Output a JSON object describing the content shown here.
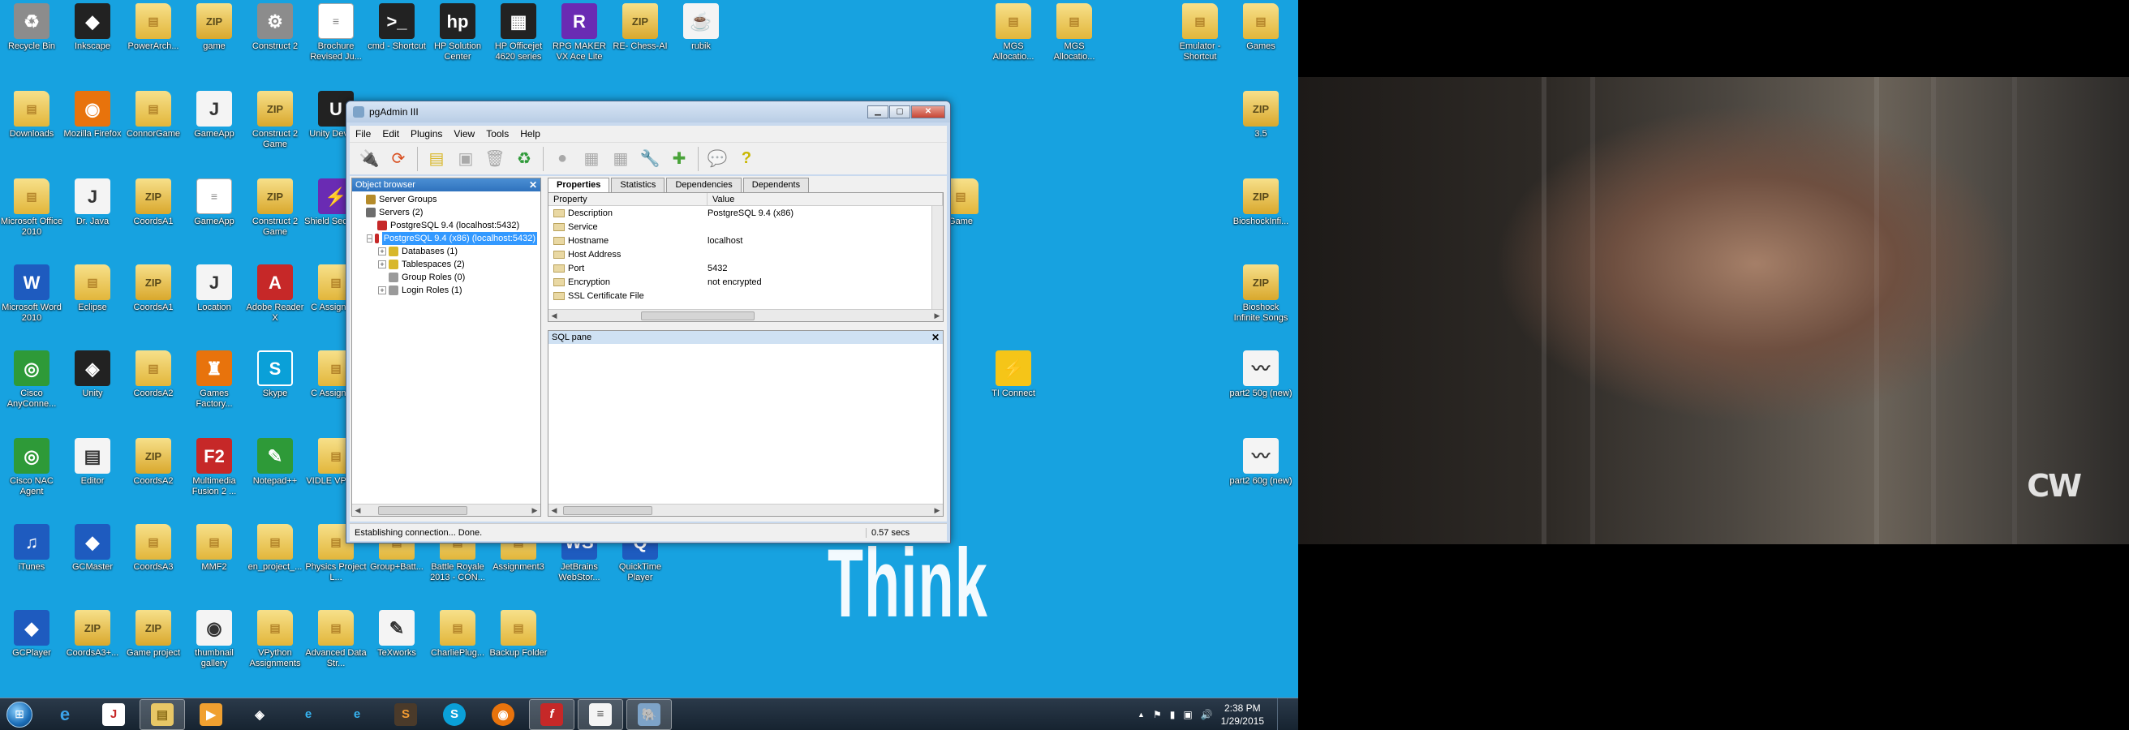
{
  "desktop": {
    "wallpaper_text": "Think",
    "icons": [
      {
        "label": "Recycle Bin",
        "glyph": "♻",
        "style": "gray"
      },
      {
        "label": "Inkscape",
        "glyph": "◆",
        "style": "dark"
      },
      {
        "label": "PowerArch...",
        "glyph": "▤",
        "style": "folder"
      },
      {
        "label": "game",
        "glyph": "ZIP",
        "style": "zip"
      },
      {
        "label": "Construct 2",
        "glyph": "⚙",
        "style": "gray"
      },
      {
        "label": "Brochure Revised Ju...",
        "glyph": "≡",
        "style": "doc"
      },
      {
        "label": "cmd - Shortcut",
        "glyph": ">_",
        "style": "dark"
      },
      {
        "label": "HP Solution Center",
        "glyph": "hp",
        "style": "dark"
      },
      {
        "label": "HP Officejet 4620 series",
        "glyph": "▦",
        "style": "dark"
      },
      {
        "label": "RPG MAKER VX Ace Lite",
        "glyph": "R",
        "style": "purple"
      },
      {
        "label": "RE- Chess-AI",
        "glyph": "ZIP",
        "style": "zip"
      },
      {
        "label": "rubik",
        "glyph": "☕",
        "style": "white"
      },
      {
        "label": "MGS Allocatio...",
        "glyph": "▤",
        "style": "folder"
      },
      {
        "label": "MGS Allocatio...",
        "glyph": "▤",
        "style": "folder"
      },
      {
        "label": "Emulator - Shortcut",
        "glyph": "▤",
        "style": "folder"
      },
      {
        "label": "Games",
        "glyph": "▤",
        "style": "folder"
      },
      {
        "label": "Downloads",
        "glyph": "▤",
        "style": "folder"
      },
      {
        "label": "Mozilla Firefox",
        "glyph": "◉",
        "style": "orange"
      },
      {
        "label": "ConnorGame",
        "glyph": "▤",
        "style": "folder"
      },
      {
        "label": "GameApp",
        "glyph": "J",
        "style": "white"
      },
      {
        "label": "Construct 2 Game",
        "glyph": "ZIP",
        "style": "zip"
      },
      {
        "label": "Unity Devel...",
        "glyph": "U",
        "style": "dark"
      },
      {
        "label": "3.5",
        "glyph": "ZIP",
        "style": "zip"
      },
      {
        "label": "Microsoft Office 2010",
        "glyph": "▤",
        "style": "folder"
      },
      {
        "label": "Dr. Java",
        "glyph": "J",
        "style": "white"
      },
      {
        "label": "CoordsA1",
        "glyph": "ZIP",
        "style": "zip"
      },
      {
        "label": "GameApp",
        "glyph": "≡",
        "style": "doc"
      },
      {
        "label": "Construct 2 Game",
        "glyph": "ZIP",
        "style": "zip"
      },
      {
        "label": "Shield Secure...",
        "glyph": "⚡",
        "style": "purple"
      },
      {
        "label": "Game",
        "glyph": "▤",
        "style": "folder"
      },
      {
        "label": "BioshockInfi...",
        "glyph": "ZIP",
        "style": "zip"
      },
      {
        "label": "Microsoft Word 2010",
        "glyph": "W",
        "style": "blue"
      },
      {
        "label": "Eclipse",
        "glyph": "▤",
        "style": "folder"
      },
      {
        "label": "CoordsA1",
        "glyph": "ZIP",
        "style": "zip"
      },
      {
        "label": "Location",
        "glyph": "J",
        "style": "white"
      },
      {
        "label": "Adobe Reader X",
        "glyph": "A",
        "style": "red"
      },
      {
        "label": "C Assignm...",
        "glyph": "▤",
        "style": "folder"
      },
      {
        "label": "Bioshock Infinite Songs",
        "glyph": "ZIP",
        "style": "zip"
      },
      {
        "label": "Cisco AnyConne...",
        "glyph": "◎",
        "style": "green"
      },
      {
        "label": "Unity",
        "glyph": "◈",
        "style": "dark"
      },
      {
        "label": "CoordsA2",
        "glyph": "▤",
        "style": "folder"
      },
      {
        "label": "Games Factory...",
        "glyph": "♜",
        "style": "orange"
      },
      {
        "label": "Skype",
        "glyph": "S",
        "style": "cyan"
      },
      {
        "label": "C Assignm...",
        "glyph": "▤",
        "style": "folder"
      },
      {
        "label": "TI Connect",
        "glyph": "⚡",
        "style": "yellow"
      },
      {
        "label": "part2 50g (new)",
        "glyph": "〰",
        "style": "white"
      },
      {
        "label": "Cisco NAC Agent",
        "glyph": "◎",
        "style": "green"
      },
      {
        "label": "Editor",
        "glyph": "▤",
        "style": "white"
      },
      {
        "label": "CoordsA2",
        "glyph": "ZIP",
        "style": "zip"
      },
      {
        "label": "Multimedia Fusion 2 ...",
        "glyph": "F2",
        "style": "red"
      },
      {
        "label": "Notepad++",
        "glyph": "✎",
        "style": "green"
      },
      {
        "label": "VIDLE VPyth...",
        "glyph": "▤",
        "style": "folder"
      },
      {
        "label": "part2 60g (new)",
        "glyph": "〰",
        "style": "white"
      },
      {
        "label": "iTunes",
        "glyph": "♫",
        "style": "blue"
      },
      {
        "label": "GCMaster",
        "glyph": "◆",
        "style": "blue"
      },
      {
        "label": "CoordsA3",
        "glyph": "▤",
        "style": "folder"
      },
      {
        "label": "MMF2",
        "glyph": "▤",
        "style": "folder"
      },
      {
        "label": "en_project_...",
        "glyph": "▤",
        "style": "folder"
      },
      {
        "label": "Physics Project L...",
        "glyph": "▤",
        "style": "folder"
      },
      {
        "label": "Group+Batt...",
        "glyph": "▤",
        "style": "folder"
      },
      {
        "label": "Battle Royale 2013 - CON...",
        "glyph": "▤",
        "style": "folder"
      },
      {
        "label": "Assignment3",
        "glyph": "▤",
        "style": "folder"
      },
      {
        "label": "JetBrains WebStor...",
        "glyph": "WS",
        "style": "blue"
      },
      {
        "label": "QuickTime Player",
        "glyph": "Q",
        "style": "blue"
      },
      {
        "label": "GCPlayer",
        "glyph": "◆",
        "style": "blue"
      },
      {
        "label": "CoordsA3+...",
        "glyph": "ZIP",
        "style": "zip"
      },
      {
        "label": "Game project",
        "glyph": "ZIP",
        "style": "zip"
      },
      {
        "label": "thumbnail gallery",
        "glyph": "◉",
        "style": "white"
      },
      {
        "label": "VPython Assignments",
        "glyph": "▤",
        "style": "folder"
      },
      {
        "label": "Advanced Data Str...",
        "glyph": "▤",
        "style": "folder"
      },
      {
        "label": "TeXworks",
        "glyph": "✎",
        "style": "white"
      },
      {
        "label": "CharliePlug...",
        "glyph": "▤",
        "style": "folder"
      },
      {
        "label": "Backup Folder",
        "glyph": "▤",
        "style": "folder"
      }
    ]
  },
  "window": {
    "title": "pgAdmin III",
    "menu": [
      "File",
      "Edit",
      "Plugins",
      "View",
      "Tools",
      "Help"
    ],
    "object_browser": {
      "title": "Object browser",
      "tree": [
        {
          "label": "Server Groups",
          "level": 0,
          "expander": ""
        },
        {
          "label": "Servers (2)",
          "level": 0,
          "expander": ""
        },
        {
          "label": "PostgreSQL 9.4 (localhost:5432)",
          "level": 1,
          "expander": ""
        },
        {
          "label": "PostgreSQL 9.4 (x86) (localhost:5432)",
          "level": 1,
          "expander": "−",
          "selected": true
        },
        {
          "label": "Databases (1)",
          "level": 2,
          "expander": "+"
        },
        {
          "label": "Tablespaces (2)",
          "level": 2,
          "expander": "+"
        },
        {
          "label": "Group Roles (0)",
          "level": 2,
          "expander": ""
        },
        {
          "label": "Login Roles (1)",
          "level": 2,
          "expander": "+"
        }
      ]
    },
    "tabs": [
      "Properties",
      "Statistics",
      "Dependencies",
      "Dependents"
    ],
    "properties": {
      "col_property": "Property",
      "col_value": "Value",
      "rows": [
        {
          "name": "Description",
          "value": "PostgreSQL 9.4 (x86)"
        },
        {
          "name": "Service",
          "value": ""
        },
        {
          "name": "Hostname",
          "value": "localhost"
        },
        {
          "name": "Host Address",
          "value": ""
        },
        {
          "name": "Port",
          "value": "5432"
        },
        {
          "name": "Encryption",
          "value": "not encrypted"
        },
        {
          "name": "SSL Certificate File",
          "value": ""
        }
      ]
    },
    "sql_pane_title": "SQL pane",
    "status": "Establishing connection... Done.",
    "status_time": "0.57 secs"
  },
  "taskbar": {
    "clock_time": "2:38 PM",
    "clock_date": "1/29/2015",
    "tray_up_arrow": "▲",
    "start_glyph": "⊞"
  },
  "video": {
    "channel_logo": "CW"
  }
}
